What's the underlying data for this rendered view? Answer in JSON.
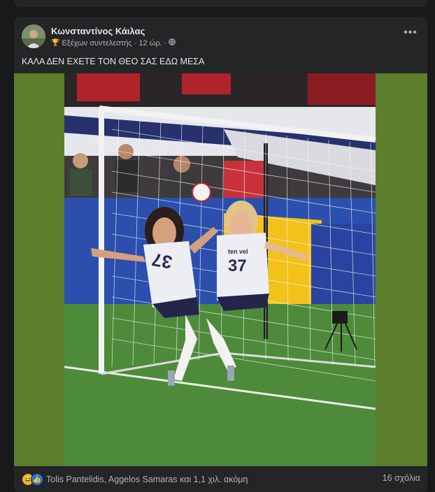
{
  "post": {
    "author": "Κωνσταντίνος Κάιλας",
    "badge_icon": "trophy-icon",
    "badge": "Εξέχων συντελεστής",
    "separator": "·",
    "time": "12 ώρ.",
    "privacy_icon": "globe-icon",
    "more_icon": "more-options-icon",
    "more_glyph": "•••",
    "text": "ΚΑΛΑ ΔΕΝ ΕΧΕΤΕ ΤΟΝ ΘΕΟ ΣΑΣ ΕΔΩ ΜΕΣΑ",
    "image": {
      "jersey_left_number": "37",
      "jersey_right_number": "37",
      "jersey_right_name": "ten vel",
      "colors": {
        "border_green": "#5c7e2d",
        "pitch": "#4d8a3a",
        "ad_board": "#2c4fae",
        "ad_yellow": "#f2c21a"
      }
    }
  },
  "footer": {
    "reaction_icons": [
      "haha-icon",
      "like-icon"
    ],
    "reactions_text": "Tolis Pantelidis, Aggelos Samaras και 1,1 χιλ. ακόμη",
    "comments": "16 σχόλια"
  },
  "colors": {
    "page_bg": "#18191a",
    "card_bg": "#242526",
    "text_primary": "#e4e6eb",
    "text_secondary": "#b0b3b8"
  }
}
